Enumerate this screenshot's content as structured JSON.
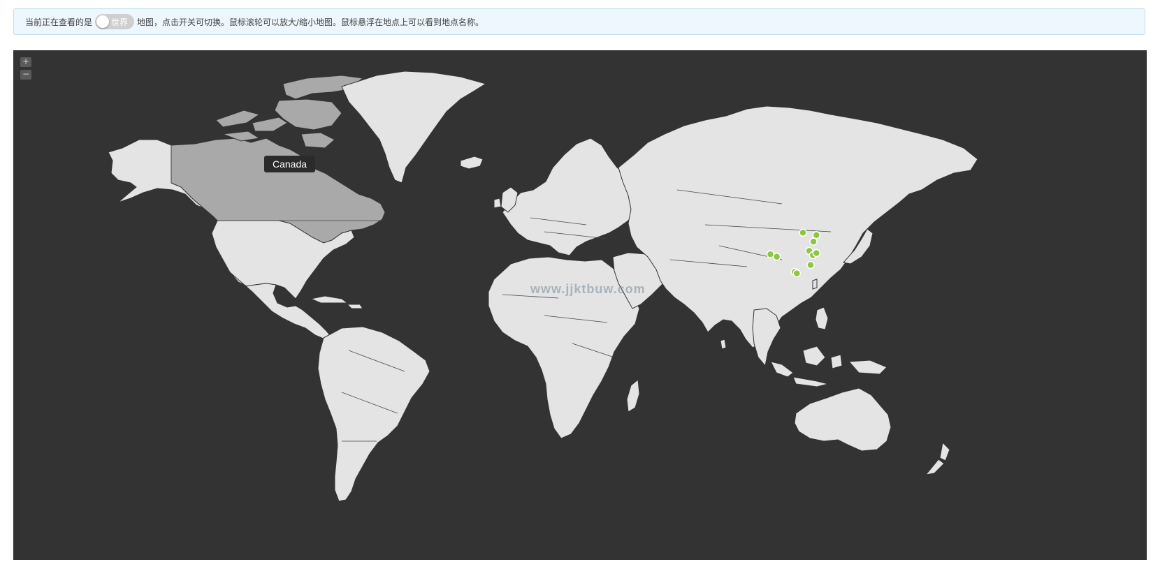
{
  "info": {
    "prefix": "当前正在查看的是",
    "toggle_label": "世界",
    "suffix": "地图，点击开关可切换。鼠标滚轮可以放大/缩小地图。鼠标悬浮在地点上可以看到地点名称。"
  },
  "map": {
    "zoom_in_label": "+",
    "zoom_out_label": "−",
    "tooltip": "Canada",
    "watermark": "www.jjktbuw.com",
    "colors": {
      "ocean": "#333333",
      "land": "#e4e4e4",
      "highlight": "#a9a9a9",
      "marker": "#8dc63f"
    },
    "highlighted_region": "Canada",
    "markers": [
      {
        "lon": 116.4,
        "lat": 39.9
      },
      {
        "lon": 121.5,
        "lat": 38.9
      },
      {
        "lon": 120.4,
        "lat": 36.1
      },
      {
        "lon": 104.1,
        "lat": 30.7
      },
      {
        "lon": 106.5,
        "lat": 29.6
      },
      {
        "lon": 118.8,
        "lat": 32.1
      },
      {
        "lon": 120.2,
        "lat": 30.3
      },
      {
        "lon": 121.5,
        "lat": 31.2
      },
      {
        "lon": 119.3,
        "lat": 26.1
      },
      {
        "lon": 113.3,
        "lat": 23.1
      },
      {
        "lon": 114.1,
        "lat": 22.5
      }
    ]
  }
}
